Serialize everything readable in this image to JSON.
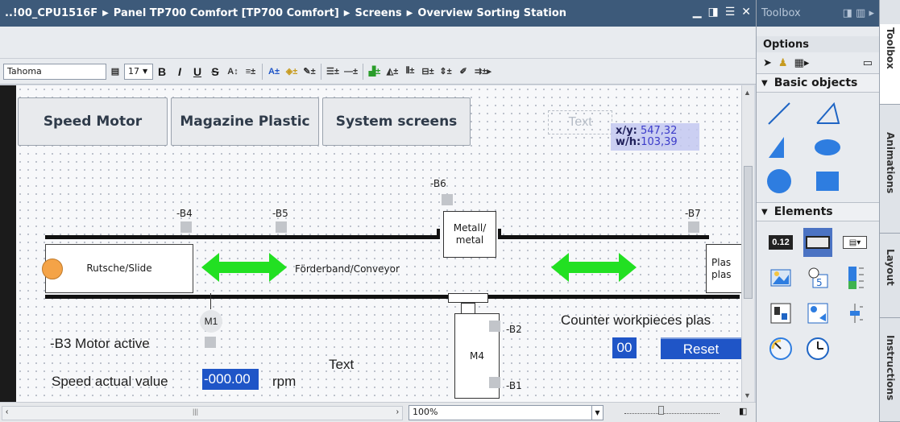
{
  "editor": {
    "breadcrumb": [
      "..!00_CPU1516F",
      "Panel TP700 Comfort [TP700 Comfort]",
      "Screens",
      "Overview Sorting Station"
    ],
    "window_controls": [
      "minimize-icon",
      "float-icon",
      "maximize-icon",
      "close-icon"
    ],
    "font_name": "Tahoma",
    "font_size": "17",
    "format_buttons": [
      "B",
      "I",
      "U",
      "S"
    ]
  },
  "screen": {
    "buttons": [
      "Speed Motor",
      "Magazine Plastic",
      "System screens"
    ],
    "ghost_text": "Text",
    "tooltip": {
      "xy_label": "x/y:",
      "xy_value": "547,32",
      "wh_label": "w/h:",
      "wh_value": "103,39"
    },
    "sensors": [
      "-B6",
      "-B4",
      "-B5",
      "-B7",
      "-B2",
      "-B1"
    ],
    "metal_box": "Metall/\nmetal",
    "slide_label": "Rutsche/Slide",
    "conveyor_label": "Förderband/Conveyor",
    "plastic_label": "Plas\nplas",
    "motor_m1": "M1",
    "motor_m4": "M4",
    "motor_active_label": "-B3 Motor active",
    "text_label": "Text",
    "speed_label": "Speed actual value",
    "speed_value": "-000.00",
    "speed_unit": "rpm",
    "counter_label": "Counter workpieces plas",
    "counter_value": "00",
    "reset_label": "Reset",
    "colors": {
      "accent": "#1f55c7",
      "arrow": "#22e022",
      "lamp": "#f4a347"
    }
  },
  "status": {
    "zoom": "100%"
  },
  "toolbox": {
    "title": "Toolbox",
    "options_label": "Options",
    "basic_objects_label": "Basic objects",
    "basic_objects": [
      "line-icon",
      "polyline-icon",
      "polygon-icon",
      "ellipse-icon",
      "circle-icon",
      "rectangle-icon"
    ],
    "elements_label": "Elements",
    "elements": [
      "io-field-icon",
      "button-icon",
      "symbolic-io-icon",
      "graphic-io-icon",
      "date-time-icon",
      "bar-icon",
      "switch-icon",
      "symbol-library-icon",
      "slider-icon",
      "gauge-icon",
      "clock-icon"
    ],
    "side_tabs": [
      "Toolbox",
      "Animations",
      "Layout",
      "Instructions"
    ]
  }
}
